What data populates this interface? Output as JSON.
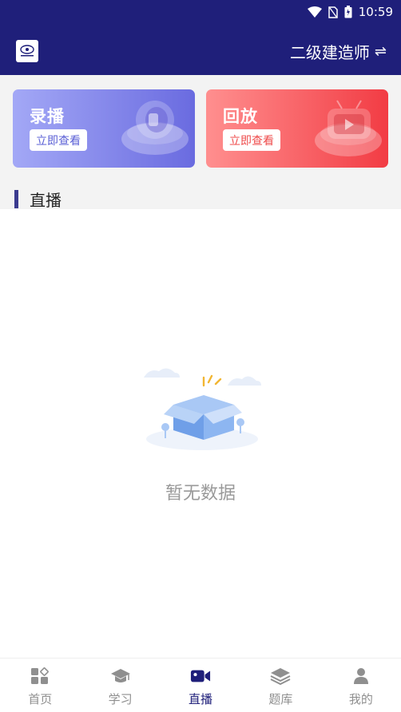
{
  "status_bar": {
    "time": "10:59",
    "wifi_icon": "wifi-icon",
    "signal_icon": "no-sim-icon",
    "battery_icon": "battery-icon"
  },
  "app_bar": {
    "exam_name": "二级建造师",
    "switch_icon": "swap-arrows-icon"
  },
  "cards": {
    "recorded": {
      "title": "录播",
      "button": "立即查看"
    },
    "replay": {
      "title": "回放",
      "button": "立即查看"
    }
  },
  "section": {
    "title": "直播"
  },
  "empty_state": {
    "text": "暂无数据"
  },
  "bottom_nav": {
    "items": [
      {
        "label": "首页",
        "icon": "home-grid-icon",
        "active": false
      },
      {
        "label": "学习",
        "icon": "graduation-cap-icon",
        "active": false
      },
      {
        "label": "直播",
        "icon": "video-camera-icon",
        "active": true
      },
      {
        "label": "题库",
        "icon": "layers-icon",
        "active": false
      },
      {
        "label": "我的",
        "icon": "user-icon",
        "active": false
      }
    ]
  },
  "colors": {
    "primary": "#1f1f7a",
    "recorded_card_start": "#a3a8f6",
    "recorded_card_end": "#6a6be0",
    "replay_card_start": "#ff8f8f",
    "replay_card_end": "#f23c44"
  }
}
